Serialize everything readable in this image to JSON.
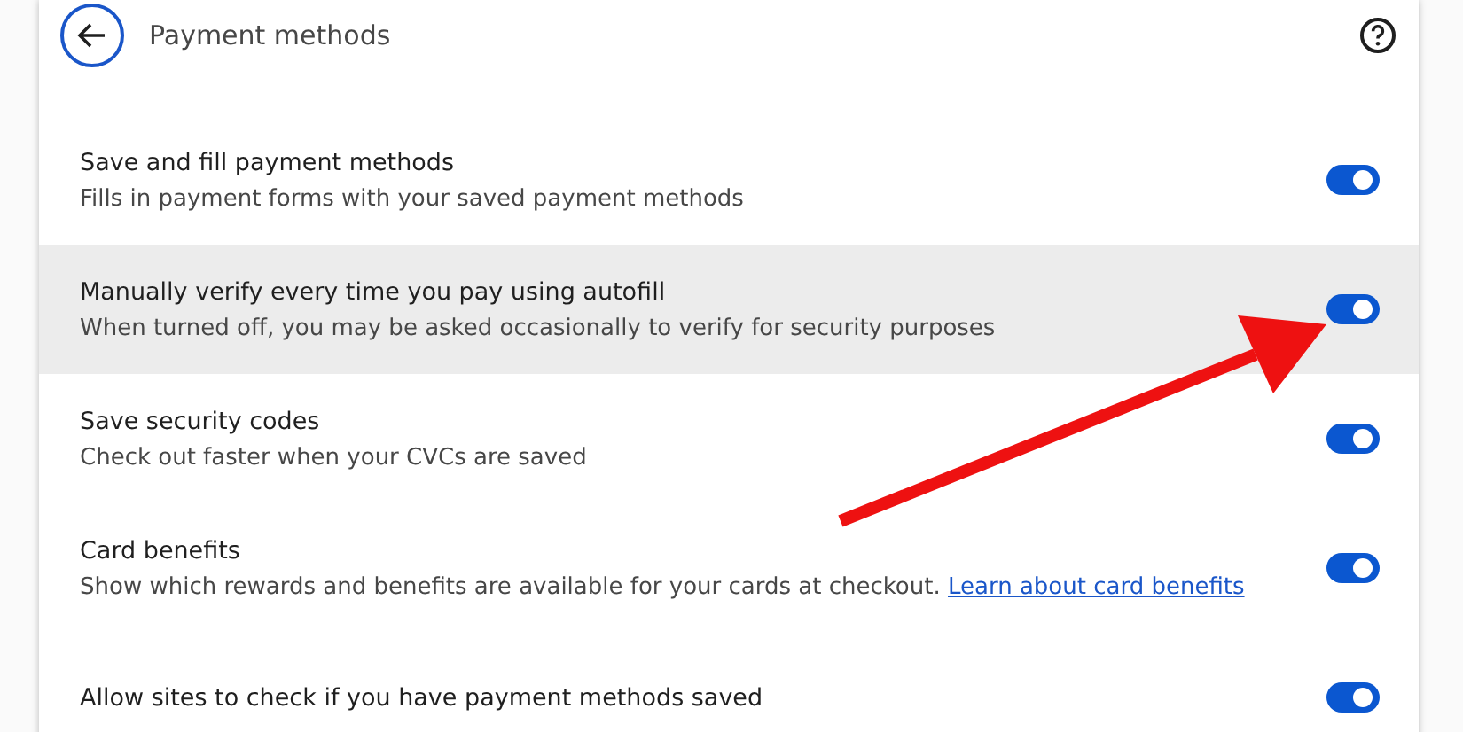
{
  "header": {
    "title": "Payment methods"
  },
  "settings": [
    {
      "title": "Save and fill payment methods",
      "description": "Fills in payment forms with your saved payment methods",
      "on": true,
      "highlighted": false
    },
    {
      "title": "Manually verify every time you pay using autofill",
      "description": "When turned off, you may be asked occasionally to verify for security purposes",
      "on": true,
      "highlighted": true
    },
    {
      "title": "Save security codes",
      "description": "Check out faster when your CVCs are saved",
      "on": true,
      "highlighted": false
    },
    {
      "title": "Card benefits",
      "description": "Show which rewards and benefits are available for your cards at checkout.",
      "link": "Learn about card benefits",
      "on": true,
      "highlighted": false
    },
    {
      "title": "Allow sites to check if you have payment methods saved",
      "on": true,
      "highlighted": false
    }
  ]
}
